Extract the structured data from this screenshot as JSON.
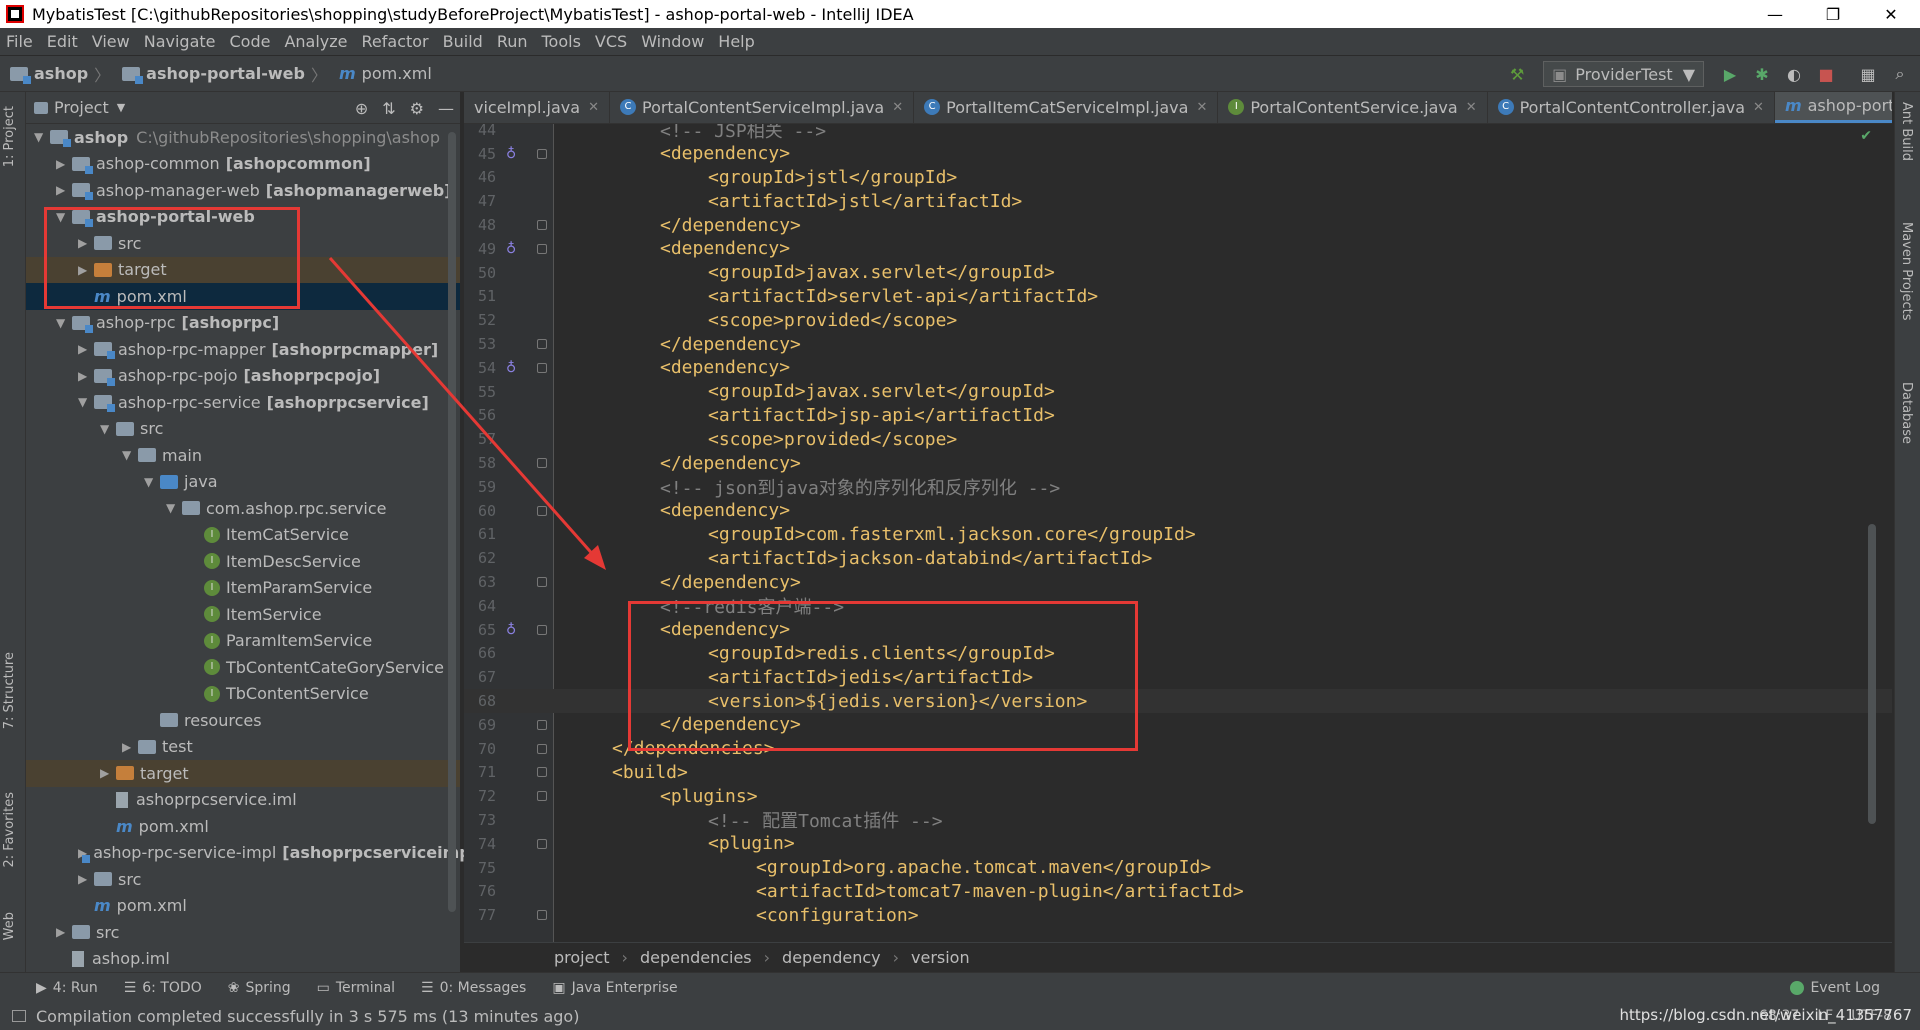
{
  "window": {
    "title": "MybatisTest [C:\\githubRepositories\\shopping\\studyBeforeProject\\MybatisTest] - ashop-portal-web - IntelliJ IDEA",
    "controls": [
      "—",
      "❐",
      "✕"
    ]
  },
  "menu": [
    "File",
    "Edit",
    "View",
    "Navigate",
    "Code",
    "Analyze",
    "Refactor",
    "Build",
    "Run",
    "Tools",
    "VCS",
    "Window",
    "Help"
  ],
  "navbar": {
    "crumbs": [
      "ashop",
      "ashop-portal-web",
      "pom.xml"
    ],
    "run_config": "ProviderTest"
  },
  "left_tabs": [
    "1: Project",
    "7: Structure",
    "2: Favorites",
    "Web"
  ],
  "right_tabs": [
    "Ant Build",
    "Maven Projects",
    "Database"
  ],
  "project": {
    "title": "Project",
    "tree": [
      {
        "text": "ashop",
        "extra": "C:\\githubRepositories\\shopping\\ashop",
        "arrow": "▼",
        "indent": 0,
        "kind": "module",
        "bold": true
      },
      {
        "text": "ashop-common",
        "extra": "[ashopcommon]",
        "arrow": "▶",
        "indent": 1,
        "kind": "module"
      },
      {
        "text": "ashop-manager-web",
        "extra": "[ashopmanagerweb]",
        "arrow": "▶",
        "indent": 1,
        "kind": "module"
      },
      {
        "text": "ashop-portal-web",
        "extra": "",
        "arrow": "▼",
        "indent": 1,
        "kind": "module",
        "bold": true
      },
      {
        "text": "src",
        "extra": "",
        "arrow": "▶",
        "indent": 2,
        "kind": "folder"
      },
      {
        "text": "target",
        "extra": "",
        "arrow": "▶",
        "indent": 2,
        "kind": "orange",
        "state": "target"
      },
      {
        "text": "pom.xml",
        "extra": "",
        "arrow": "",
        "indent": 2,
        "kind": "maven",
        "state": "selected"
      },
      {
        "text": "ashop-rpc",
        "extra": "[ashoprpc]",
        "arrow": "▼",
        "indent": 1,
        "kind": "module"
      },
      {
        "text": "ashop-rpc-mapper",
        "extra": "[ashoprpcmapper]",
        "arrow": "▶",
        "indent": 2,
        "kind": "module"
      },
      {
        "text": "ashop-rpc-pojo",
        "extra": "[ashoprpcpojo]",
        "arrow": "▶",
        "indent": 2,
        "kind": "module"
      },
      {
        "text": "ashop-rpc-service",
        "extra": "[ashoprpcservice]",
        "arrow": "▼",
        "indent": 2,
        "kind": "module"
      },
      {
        "text": "src",
        "extra": "",
        "arrow": "▼",
        "indent": 3,
        "kind": "folder"
      },
      {
        "text": "main",
        "extra": "",
        "arrow": "▼",
        "indent": 4,
        "kind": "folder"
      },
      {
        "text": "java",
        "extra": "",
        "arrow": "▼",
        "indent": 5,
        "kind": "folder-blue"
      },
      {
        "text": "com.ashop.rpc.service",
        "extra": "",
        "arrow": "▼",
        "indent": 6,
        "kind": "folder"
      },
      {
        "text": "ItemCatService",
        "extra": "",
        "arrow": "",
        "indent": 7,
        "kind": "iface"
      },
      {
        "text": "ItemDescService",
        "extra": "",
        "arrow": "",
        "indent": 7,
        "kind": "iface"
      },
      {
        "text": "ItemParamService",
        "extra": "",
        "arrow": "",
        "indent": 7,
        "kind": "iface"
      },
      {
        "text": "ItemService",
        "extra": "",
        "arrow": "",
        "indent": 7,
        "kind": "iface"
      },
      {
        "text": "ParamItemService",
        "extra": "",
        "arrow": "",
        "indent": 7,
        "kind": "iface"
      },
      {
        "text": "TbContentCateGoryService",
        "extra": "",
        "arrow": "",
        "indent": 7,
        "kind": "iface"
      },
      {
        "text": "TbContentService",
        "extra": "",
        "arrow": "",
        "indent": 7,
        "kind": "iface"
      },
      {
        "text": "resources",
        "extra": "",
        "arrow": "",
        "indent": 5,
        "kind": "folder"
      },
      {
        "text": "test",
        "extra": "",
        "arrow": "▶",
        "indent": 4,
        "kind": "folder"
      },
      {
        "text": "target",
        "extra": "",
        "arrow": "▶",
        "indent": 3,
        "kind": "orange",
        "state": "target"
      },
      {
        "text": "ashoprpcservice.iml",
        "extra": "",
        "arrow": "",
        "indent": 3,
        "kind": "file"
      },
      {
        "text": "pom.xml",
        "extra": "",
        "arrow": "",
        "indent": 3,
        "kind": "maven"
      },
      {
        "text": "ashop-rpc-service-impl",
        "extra": "[ashoprpcserviceimpl]",
        "arrow": "▶",
        "indent": 2,
        "kind": "module"
      },
      {
        "text": "src",
        "extra": "",
        "arrow": "▶",
        "indent": 2,
        "kind": "folder"
      },
      {
        "text": "pom.xml",
        "extra": "",
        "arrow": "",
        "indent": 2,
        "kind": "maven"
      },
      {
        "text": "src",
        "extra": "",
        "arrow": "▶",
        "indent": 1,
        "kind": "folder"
      },
      {
        "text": "ashop.iml",
        "extra": "",
        "arrow": "",
        "indent": 1,
        "kind": "file"
      }
    ]
  },
  "tabs": [
    {
      "label": "viceImpl.java",
      "icon": "",
      "active": false
    },
    {
      "label": "PortalContentServiceImpl.java",
      "icon": "c",
      "active": false
    },
    {
      "label": "PortalItemCatServiceImpl.java",
      "icon": "c",
      "active": false
    },
    {
      "label": "PortalContentService.java",
      "icon": "i",
      "active": false
    },
    {
      "label": "PortalContentController.java",
      "icon": "c",
      "active": false
    },
    {
      "label": "ashop-portal-web",
      "icon": "m",
      "active": true
    }
  ],
  "code": [
    {
      "n": "44",
      "indent": 2,
      "text": "<!-- JSP相关 -->",
      "kind": "comment"
    },
    {
      "n": "45",
      "indent": 2,
      "text": "<dependency>",
      "kind": "tag"
    },
    {
      "n": "46",
      "indent": 3,
      "text": "<groupId>jstl</groupId>",
      "kind": "tag"
    },
    {
      "n": "47",
      "indent": 3,
      "text": "<artifactId>jstl</artifactId>",
      "kind": "tag"
    },
    {
      "n": "48",
      "indent": 2,
      "text": "</dependency>",
      "kind": "tag"
    },
    {
      "n": "49",
      "indent": 2,
      "text": "<dependency>",
      "kind": "tag"
    },
    {
      "n": "50",
      "indent": 3,
      "text": "<groupId>javax.servlet</groupId>",
      "kind": "tag"
    },
    {
      "n": "51",
      "indent": 3,
      "text": "<artifactId>servlet-api</artifactId>",
      "kind": "tag"
    },
    {
      "n": "52",
      "indent": 3,
      "text": "<scope>provided</scope>",
      "kind": "tag"
    },
    {
      "n": "53",
      "indent": 2,
      "text": "</dependency>",
      "kind": "tag"
    },
    {
      "n": "54",
      "indent": 2,
      "text": "<dependency>",
      "kind": "tag"
    },
    {
      "n": "55",
      "indent": 3,
      "text": "<groupId>javax.servlet</groupId>",
      "kind": "tag"
    },
    {
      "n": "56",
      "indent": 3,
      "text": "<artifactId>jsp-api</artifactId>",
      "kind": "tag"
    },
    {
      "n": "57",
      "indent": 3,
      "text": "<scope>provided</scope>",
      "kind": "tag"
    },
    {
      "n": "58",
      "indent": 2,
      "text": "</dependency>",
      "kind": "tag"
    },
    {
      "n": "59",
      "indent": 2,
      "text": "<!-- json到java对象的序列化和反序列化 -->",
      "kind": "comment"
    },
    {
      "n": "60",
      "indent": 2,
      "text": "<dependency>",
      "kind": "tag"
    },
    {
      "n": "61",
      "indent": 3,
      "text": "<groupId>com.fasterxml.jackson.core</groupId>",
      "kind": "tag"
    },
    {
      "n": "62",
      "indent": 3,
      "text": "<artifactId>jackson-databind</artifactId>",
      "kind": "tag"
    },
    {
      "n": "63",
      "indent": 2,
      "text": "</dependency>",
      "kind": "tag"
    },
    {
      "n": "64",
      "indent": 2,
      "text": "<!--redis客户端-->",
      "kind": "comment"
    },
    {
      "n": "65",
      "indent": 2,
      "text": "<dependency>",
      "kind": "tag"
    },
    {
      "n": "66",
      "indent": 3,
      "text": "<groupId>redis.clients</groupId>",
      "kind": "tag"
    },
    {
      "n": "67",
      "indent": 3,
      "text": "<artifactId>jedis</artifactId>",
      "kind": "tag"
    },
    {
      "n": "68",
      "indent": 3,
      "text": "<version>${jedis.version}</version>",
      "kind": "tag",
      "current": true
    },
    {
      "n": "69",
      "indent": 2,
      "text": "</dependency>",
      "kind": "tag"
    },
    {
      "n": "70",
      "indent": 1,
      "text": "</dependencies>",
      "kind": "tag"
    },
    {
      "n": "71",
      "indent": 1,
      "text": "<build>",
      "kind": "tag"
    },
    {
      "n": "72",
      "indent": 2,
      "text": "<plugins>",
      "kind": "tag"
    },
    {
      "n": "73",
      "indent": 3,
      "text": "<!-- 配置Tomcat插件 -->",
      "kind": "comment"
    },
    {
      "n": "74",
      "indent": 3,
      "text": "<plugin>",
      "kind": "tag"
    },
    {
      "n": "75",
      "indent": 4,
      "text": "<groupId>org.apache.tomcat.maven</groupId>",
      "kind": "tag"
    },
    {
      "n": "76",
      "indent": 4,
      "text": "<artifactId>tomcat7-maven-plugin</artifactId>",
      "kind": "tag"
    },
    {
      "n": "77",
      "indent": 4,
      "text": "<configuration>",
      "kind": "tag"
    }
  ],
  "editor_crumbs": [
    "project",
    "dependencies",
    "dependency",
    "version"
  ],
  "bottom_tools": [
    "4: Run",
    "6: TODO",
    "Spring",
    "Terminal",
    "0: Messages",
    "Java Enterprise"
  ],
  "event_log": "Event Log",
  "status": {
    "message": "Compilation completed successfully in 3 s 575 ms (13 minutes ago)",
    "position": "68:37",
    "line_sep": "LF",
    "encoding": "UTF-8",
    "watermark": "https://blog.csdn.net/weixin_41357767"
  },
  "colors": {
    "accent": "#4a88c7",
    "highlight_box": "#e53935"
  }
}
